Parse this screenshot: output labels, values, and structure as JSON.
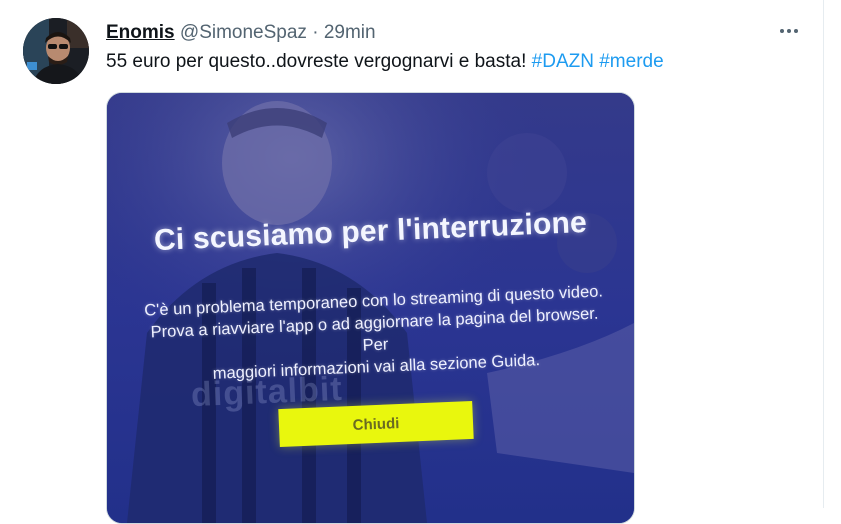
{
  "tweet": {
    "author_name": "Enomis",
    "handle": "@SimoneSpaz",
    "separator": "·",
    "time": "29min",
    "more_icon": "ellipsis-icon",
    "text": "55 euro per questo..dovreste vergognarvi e basta!",
    "hashtags": [
      "#DAZN",
      "#merde"
    ]
  },
  "media": {
    "title": "Ci scusiamo per l'interruzione",
    "message_lines": [
      "C'è un problema temporaneo con lo streaming di questo video.",
      "Prova a riavviare l'app o ad aggiornare la pagina del browser. Per",
      "maggiori informazioni vai alla sezione Guida."
    ],
    "watermark": "digitalbit",
    "button_label": "Chiudi",
    "colors": {
      "overlay": "#26338a",
      "button": "#e9f70d"
    }
  },
  "colors": {
    "hashtag": "#1d9bf0",
    "secondary": "#536471"
  }
}
